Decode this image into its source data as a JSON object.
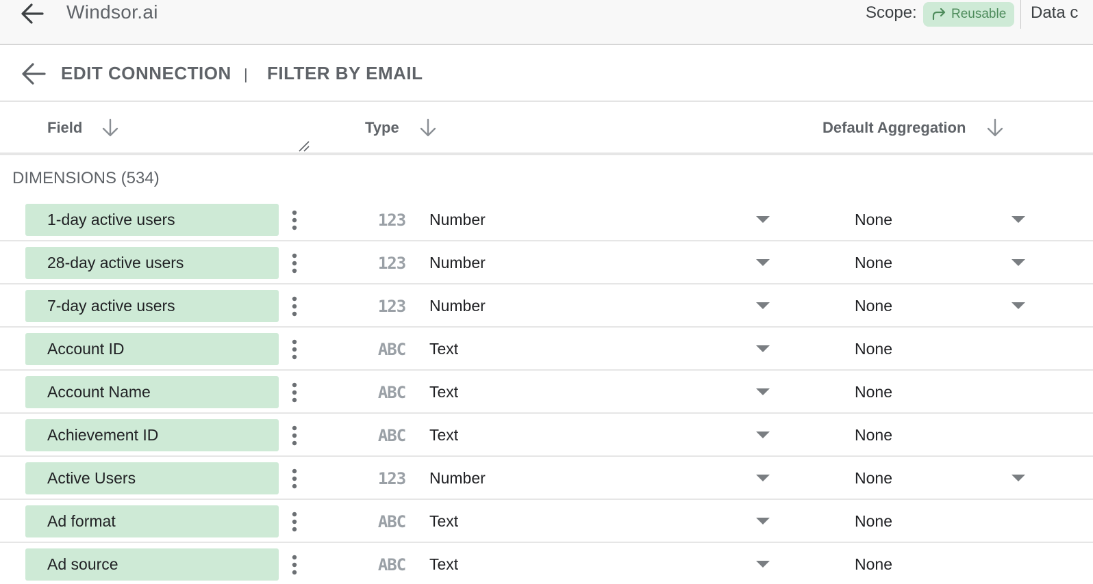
{
  "header": {
    "app_title": "Windsor.ai",
    "scope_label": "Scope:",
    "scope_chip": "Reusable",
    "data_label": "Data c"
  },
  "subheader": {
    "edit_connection": "EDIT CONNECTION",
    "separator": "|",
    "filter_by_email": "FILTER BY EMAIL"
  },
  "columns": {
    "field": "Field",
    "type": "Type",
    "default_aggregation": "Default Aggregation"
  },
  "section": {
    "title": "DIMENSIONS (534)"
  },
  "type_icons": {
    "number": "123",
    "text": "ABC"
  },
  "rows": [
    {
      "field": "1-day active users",
      "type_icon": "123",
      "type": "Number",
      "aggregation": "None",
      "aggregation_dropdown": true
    },
    {
      "field": "28-day active users",
      "type_icon": "123",
      "type": "Number",
      "aggregation": "None",
      "aggregation_dropdown": true
    },
    {
      "field": "7-day active users",
      "type_icon": "123",
      "type": "Number",
      "aggregation": "None",
      "aggregation_dropdown": true
    },
    {
      "field": "Account ID",
      "type_icon": "ABC",
      "type": "Text",
      "aggregation": "None",
      "aggregation_dropdown": false
    },
    {
      "field": "Account Name",
      "type_icon": "ABC",
      "type": "Text",
      "aggregation": "None",
      "aggregation_dropdown": false
    },
    {
      "field": "Achievement ID",
      "type_icon": "ABC",
      "type": "Text",
      "aggregation": "None",
      "aggregation_dropdown": false
    },
    {
      "field": "Active Users",
      "type_icon": "123",
      "type": "Number",
      "aggregation": "None",
      "aggregation_dropdown": true
    },
    {
      "field": "Ad format",
      "type_icon": "ABC",
      "type": "Text",
      "aggregation": "None",
      "aggregation_dropdown": false
    },
    {
      "field": "Ad source",
      "type_icon": "ABC",
      "type": "Text",
      "aggregation": "None",
      "aggregation_dropdown": false
    }
  ],
  "colors": {
    "field_chip": "#ceead6",
    "scope_chip": "#ceead6",
    "scope_chip_text": "#4d8b5b",
    "header_text": "#5f6368",
    "icon_gray": "#9aa0a6"
  }
}
